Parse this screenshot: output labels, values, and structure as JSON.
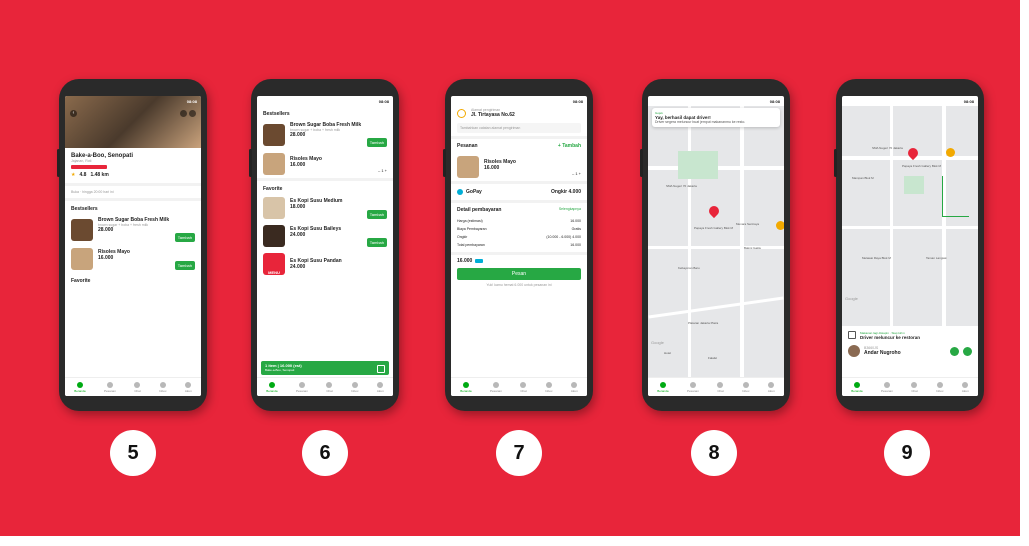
{
  "steps": [
    "5",
    "6",
    "7",
    "8",
    "9"
  ],
  "status_time": "08:08",
  "tabs": [
    "Beranda",
    "Pesanan",
    "Chat",
    "Inbox",
    "Akun"
  ],
  "screen5": {
    "restaurant": "Bake-a-Boo, Senopati",
    "category": "Jajanan, Roti",
    "rating": "4.8",
    "distance": "1.48 km",
    "hours": "Buka · hingga 20:00 hari ini",
    "section": "Bestsellers",
    "items": [
      {
        "name": "Brown Sugar Boba Fresh Milk",
        "desc": "brown sugar + boba + fresh milk",
        "price": "28.000",
        "button": "Tambah"
      },
      {
        "name": "Risoles Mayo",
        "desc": "",
        "price": "16.000",
        "button": "Tambah"
      }
    ],
    "footer_section": "Favorite"
  },
  "screen6": {
    "section1": "Bestsellers",
    "items1": [
      {
        "name": "Brown Sugar Boba Fresh Milk",
        "desc": "brown sugar + boba + fresh milk",
        "price": "28.000",
        "button": "Tambah"
      },
      {
        "name": "Risoles Mayo",
        "price": "16.000",
        "qty": "1"
      }
    ],
    "section2": "Favorite",
    "items2": [
      {
        "name": "Es Kopi Susu Medium",
        "price": "18.000",
        "button": "Tambah"
      },
      {
        "name": "Es Kopi Susu Baileys",
        "price": "24.000",
        "button": "Tambah"
      },
      {
        "name": "Es Kopi Susu Pandan",
        "price": "24.000"
      }
    ],
    "menu_badge": "MENU",
    "cart_text": "1 item | 16.000 (est)",
    "cart_sub": "Bake-a-Boo, Senopati"
  },
  "screen7": {
    "address_label": "Alamat pengiriman",
    "address": "Jl. Tirtayasa No.62",
    "note": "Tambahkan catatan alamat pengiriman",
    "order_label": "Pesanan",
    "add_label": "+ Tambah",
    "item": {
      "name": "Risoles Mayo",
      "price": "16.000",
      "qty": "1"
    },
    "payment": "GoPay",
    "shipping": "Ongkir 4.000",
    "detail_title": "Detail pembayaran",
    "detail_link": "Selengkapnya",
    "lines": [
      {
        "label": "Harga (estimasi)",
        "value": "16.000"
      },
      {
        "label": "Biaya Pembayaran",
        "value": "Gratis"
      },
      {
        "label": "Ongkir",
        "value": "(10.000 - 6.000) 4.000"
      },
      {
        "label": "Total pembayaran",
        "value": "16.000"
      }
    ],
    "total": "16.000",
    "button": "Pesan",
    "footer": "Yuk! kamu hemat 6.000 untuk pesanan ini"
  },
  "screen8": {
    "app": "Gojek",
    "title": "Yay, berhasil dapat driver!",
    "message": "Driver segera meluncur buat jemput makananmu ke resto.",
    "places": [
      "SMA Negeri 70 Jakarta",
      "Papaya Fresh Gallery Blok M",
      "Menara Sentraya",
      "Kebayoran Baru",
      "Plataran Jakarta Plaza",
      "Hotel",
      "Bakmi Gaktu",
      "Falafel"
    ]
  },
  "screen9": {
    "places": [
      "SMA Negeri 70 Jakarta",
      "Mampan Blok M",
      "Papaya Fresh Gallery Blok M",
      "Melawai Raya Blok M",
      "Taman Langsat"
    ],
    "status_small": "Makanan lagi disiapin · Siap kirim",
    "status": "Driver meluncur ke restoran",
    "driver_plate": "B3660JS",
    "driver_name": "Andar Nugroho"
  },
  "colors": {
    "background": "#e8253a",
    "accent": "#27a844",
    "phone": "#2a2a2a"
  }
}
